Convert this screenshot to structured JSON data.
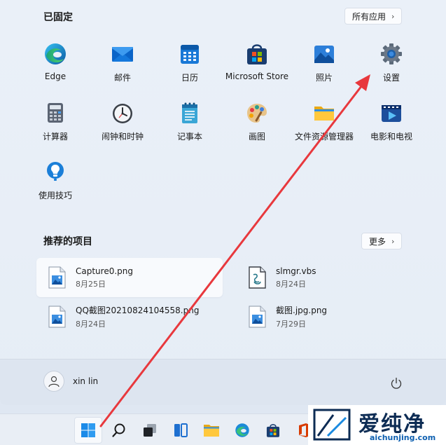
{
  "pinned": {
    "title": "已固定",
    "all_apps_label": "所有应用",
    "apps": [
      {
        "label": "Edge",
        "icon": "edge-icon"
      },
      {
        "label": "邮件",
        "icon": "mail-icon"
      },
      {
        "label": "日历",
        "icon": "calendar-icon"
      },
      {
        "label": "Microsoft Store",
        "icon": "store-icon"
      },
      {
        "label": "照片",
        "icon": "photos-icon"
      },
      {
        "label": "设置",
        "icon": "settings-icon"
      },
      {
        "label": "计算器",
        "icon": "calculator-icon"
      },
      {
        "label": "闹钟和时钟",
        "icon": "alarm-clock-icon"
      },
      {
        "label": "记事本",
        "icon": "notepad-icon"
      },
      {
        "label": "画图",
        "icon": "paint-icon"
      },
      {
        "label": "文件资源管理器",
        "icon": "file-explorer-icon"
      },
      {
        "label": "电影和电视",
        "icon": "movies-tv-icon"
      },
      {
        "label": "使用技巧",
        "icon": "tips-icon"
      }
    ]
  },
  "recommended": {
    "title": "推荐的项目",
    "more_label": "更多",
    "items": [
      {
        "name": "Capture0.png",
        "date": "8月25日",
        "icon": "image-file-icon"
      },
      {
        "name": "slmgr.vbs",
        "date": "8月24日",
        "icon": "script-file-icon"
      },
      {
        "name": "QQ截图20210824104558.png",
        "date": "8月24日",
        "icon": "image-file-icon"
      },
      {
        "name": "截图.jpg.png",
        "date": "7月29日",
        "icon": "image-file-icon"
      }
    ]
  },
  "user": {
    "name": "xin lin"
  },
  "watermark": {
    "brand": "爱纯净",
    "url": "aichunjing.com"
  },
  "colors": {
    "accent": "#0067c0",
    "arrow": "#e8383d"
  }
}
